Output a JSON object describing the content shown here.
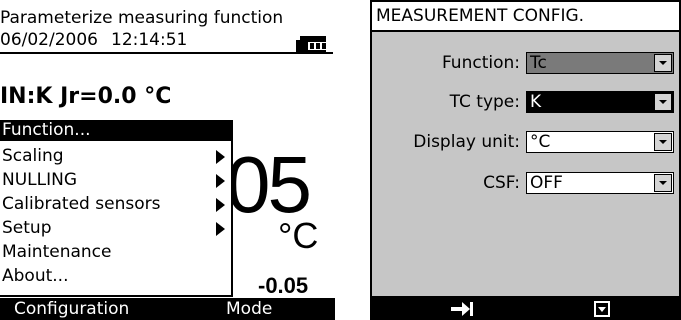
{
  "left_screen": {
    "header": {
      "title": "Parameterize measuring function",
      "date": "06/02/2006",
      "time": "12:14:51"
    },
    "input_line": "IN:K Jr=0.0 °C",
    "reading": {
      "main_value": "05",
      "unit": "°C",
      "secondary_value": "-0.05"
    },
    "menu": {
      "items": [
        {
          "label": "Function...",
          "has_submenu": false,
          "selected": true
        },
        {
          "label": "Scaling",
          "has_submenu": true
        },
        {
          "label": "NULLING",
          "has_submenu": true
        },
        {
          "label": "Calibrated sensors",
          "has_submenu": true
        },
        {
          "label": "Setup",
          "has_submenu": true
        },
        {
          "label": "Maintenance",
          "has_submenu": false
        },
        {
          "label": "About...",
          "has_submenu": false
        }
      ]
    },
    "footer": {
      "left": "Configuration",
      "right": "Mode"
    }
  },
  "right_screen": {
    "title": "MEASUREMENT CONFIG.",
    "fields": [
      {
        "label": "Function:",
        "value": "Tc"
      },
      {
        "label": "TC type:",
        "value": "K"
      },
      {
        "label": "Display unit:",
        "value": "°C"
      },
      {
        "label": "CSF:",
        "value": "OFF"
      }
    ],
    "footer": {
      "left_icon": "next-field-icon",
      "right_icon": "dropdown-open-icon"
    }
  },
  "colors": {
    "panel_gray": "#c6c6c6",
    "highlight_gray": "#7a7a7a",
    "black": "#000000",
    "white": "#ffffff"
  }
}
